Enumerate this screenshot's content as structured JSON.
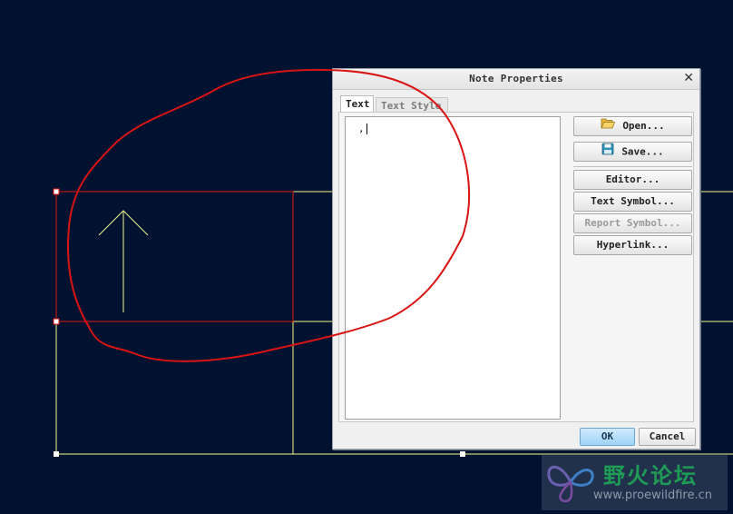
{
  "dialog": {
    "title": "Note Properties",
    "close_glyph": "✕",
    "tabs": [
      {
        "label": "Text",
        "active": true
      },
      {
        "label": "Text Style",
        "active": false
      }
    ],
    "text_content": ",",
    "buttons": {
      "open": "Open...",
      "save": "Save...",
      "editor": "Editor...",
      "text_symbol": "Text Symbol...",
      "report_symbol": "Report Symbol...",
      "hyperlink": "Hyperlink...",
      "ok": "OK",
      "cancel": "Cancel"
    },
    "icons": {
      "open": "folder-open-icon",
      "save": "floppy-disk-icon"
    }
  },
  "watermark": {
    "logo_text": "野火论坛",
    "url": "www.proewildfire.cn"
  },
  "colors": {
    "background": "#011230",
    "sketch_lines": "#f2f58a",
    "selection": "#e01515",
    "annotation_circle": "#d81414",
    "ok_button": "#9dd3f6"
  }
}
